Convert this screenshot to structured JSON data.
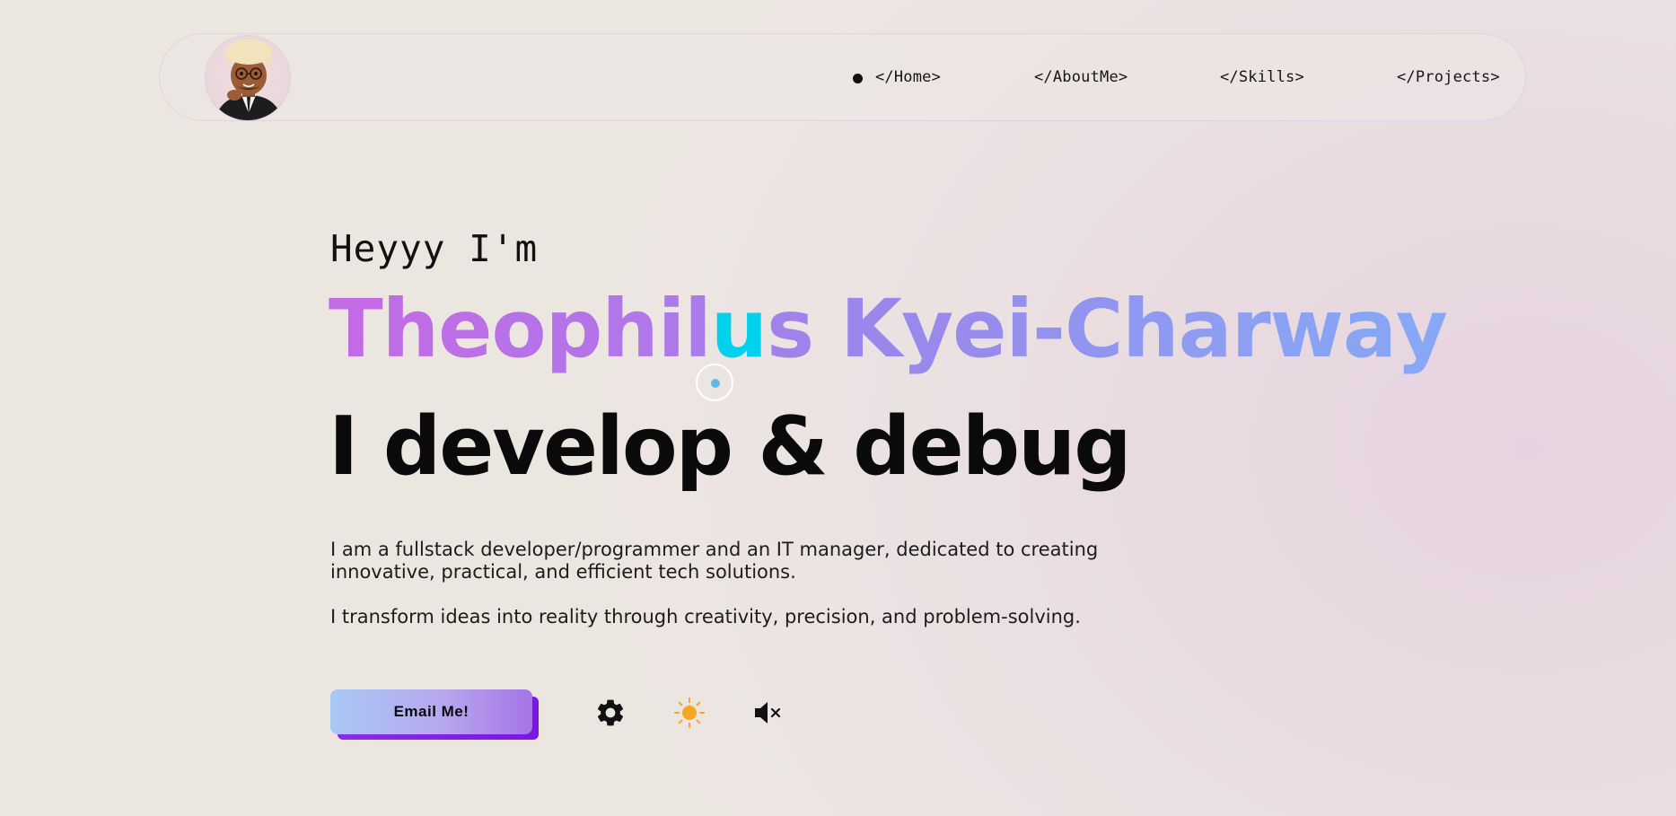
{
  "nav": {
    "avatar_alt": "Profile avatar",
    "links": [
      {
        "label": "</Home>",
        "active": true
      },
      {
        "label": "</AboutMe>"
      },
      {
        "label": "</Skills>"
      },
      {
        "label": "</Projects>"
      }
    ]
  },
  "hero": {
    "greeting": "Heyyy I'm",
    "name": "Theophilus Kyei-Charway",
    "name_gradient": [
      "#c36ae6",
      "#9b86ec",
      "#86a8f5"
    ],
    "name_highlight_color": "#00d2ee",
    "tagline": "I develop & debug",
    "paragraph_1": "I am a fullstack developer/programmer and an IT manager, dedicated to creating innovative, practical, and efficient tech solutions.",
    "paragraph_2": "I transform ideas into reality through creativity, precision, and problem-solving."
  },
  "actions": {
    "email_label": "Email Me!",
    "settings_icon": "gear-icon",
    "theme_icon": "sun-icon",
    "sound_icon": "speaker-muted-icon",
    "accent_color": "#7b16e8",
    "sun_color": "#f5a623"
  }
}
